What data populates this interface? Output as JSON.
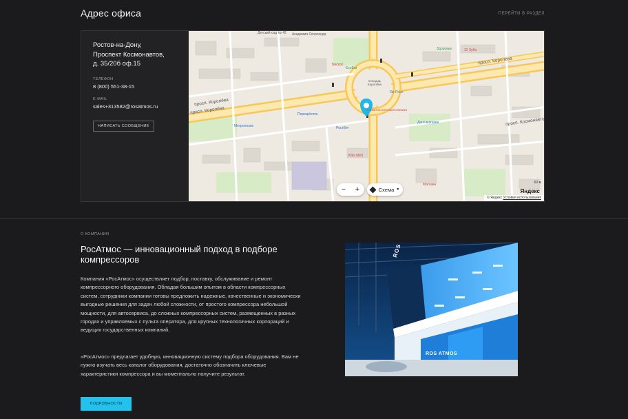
{
  "office": {
    "title": "Адрес офиса",
    "goto_link": "Перейти в раздел",
    "address_line1": "Ростов-на-Дону,",
    "address_line2": "Проспект Космонавтов,",
    "address_line3": "д. 35/20б оф.15",
    "phone_label": "Телефон",
    "phone": "8 (800) 551-38-15",
    "email_label": "E-mail",
    "email": "sales+313582@rosatmos.ru",
    "write_button": "Написать сообщение"
  },
  "map": {
    "streets": {
      "korolyova_1": "просп. Королёва",
      "korolyova_2": "просп. Королёва",
      "korolyova_3": "просп. Королёва",
      "kosmonavtov": "просп. Космонавтов",
      "square": "площадь Королёва"
    },
    "places": {
      "kindergarten": "Детский сад № 42",
      "academy": "Академия Скорохода",
      "health": "Здоровье",
      "apteka": "32 Зуба",
      "ecoeat": "EcoEat",
      "bistro": "Бистро",
      "perekrestok": "Перекрёсток",
      "metropolis": "Метрополис",
      "rostvet": "РостВет",
      "fixprice": "Fix Price",
      "dental": "Стоматологическая клиника",
      "dentshop": "Дент-магазин",
      "kids": "Kids Med",
      "shop": "Магазин"
    },
    "zoom_out": "−",
    "zoom_in": "+",
    "scheme_label": "Схема",
    "scale": "60 м",
    "yandex": "Яндекс",
    "copyright": "© Яндекс",
    "terms": "Условия использования"
  },
  "about": {
    "kicker": "О компании",
    "title": "РосАтмос — инновационный подход в подборе компрессоров",
    "paragraph1": "Компания «РосАтмос»  осуществляет подбор, поставку, обслуживание и ремонт компрессорного оборудования. Обладая большим опытом в области компрессорных систем, сотрудники компании готовы предложить надежные, качественные и экономически выгодные решения для задач любой сложности, от простого компрессора небольшой мощности, для автосервиса, до сложных компрессорных систем, размещенных в разных городах и управляемых с пульта оператора, для крупных технологичных корпораций и ведущих государственных компаний.",
    "paragraph2": "«РосАтмос»  предлагает удобную, инновационную систему подбора оборудования. Вам не нужно изучать весь каталог оборудования, достаточно обозначить ключевые характеристики компрессора и вы моментально получите результат.",
    "more_button": "Подробности",
    "photo_sign_top": "ROS ATMOS",
    "photo_sign_bottom": "ROS ATMOS"
  },
  "colors": {
    "background": "#1b1b1d",
    "accent": "#22c2ee",
    "road": "#f7c75a",
    "pin": "#1fb8e8"
  }
}
